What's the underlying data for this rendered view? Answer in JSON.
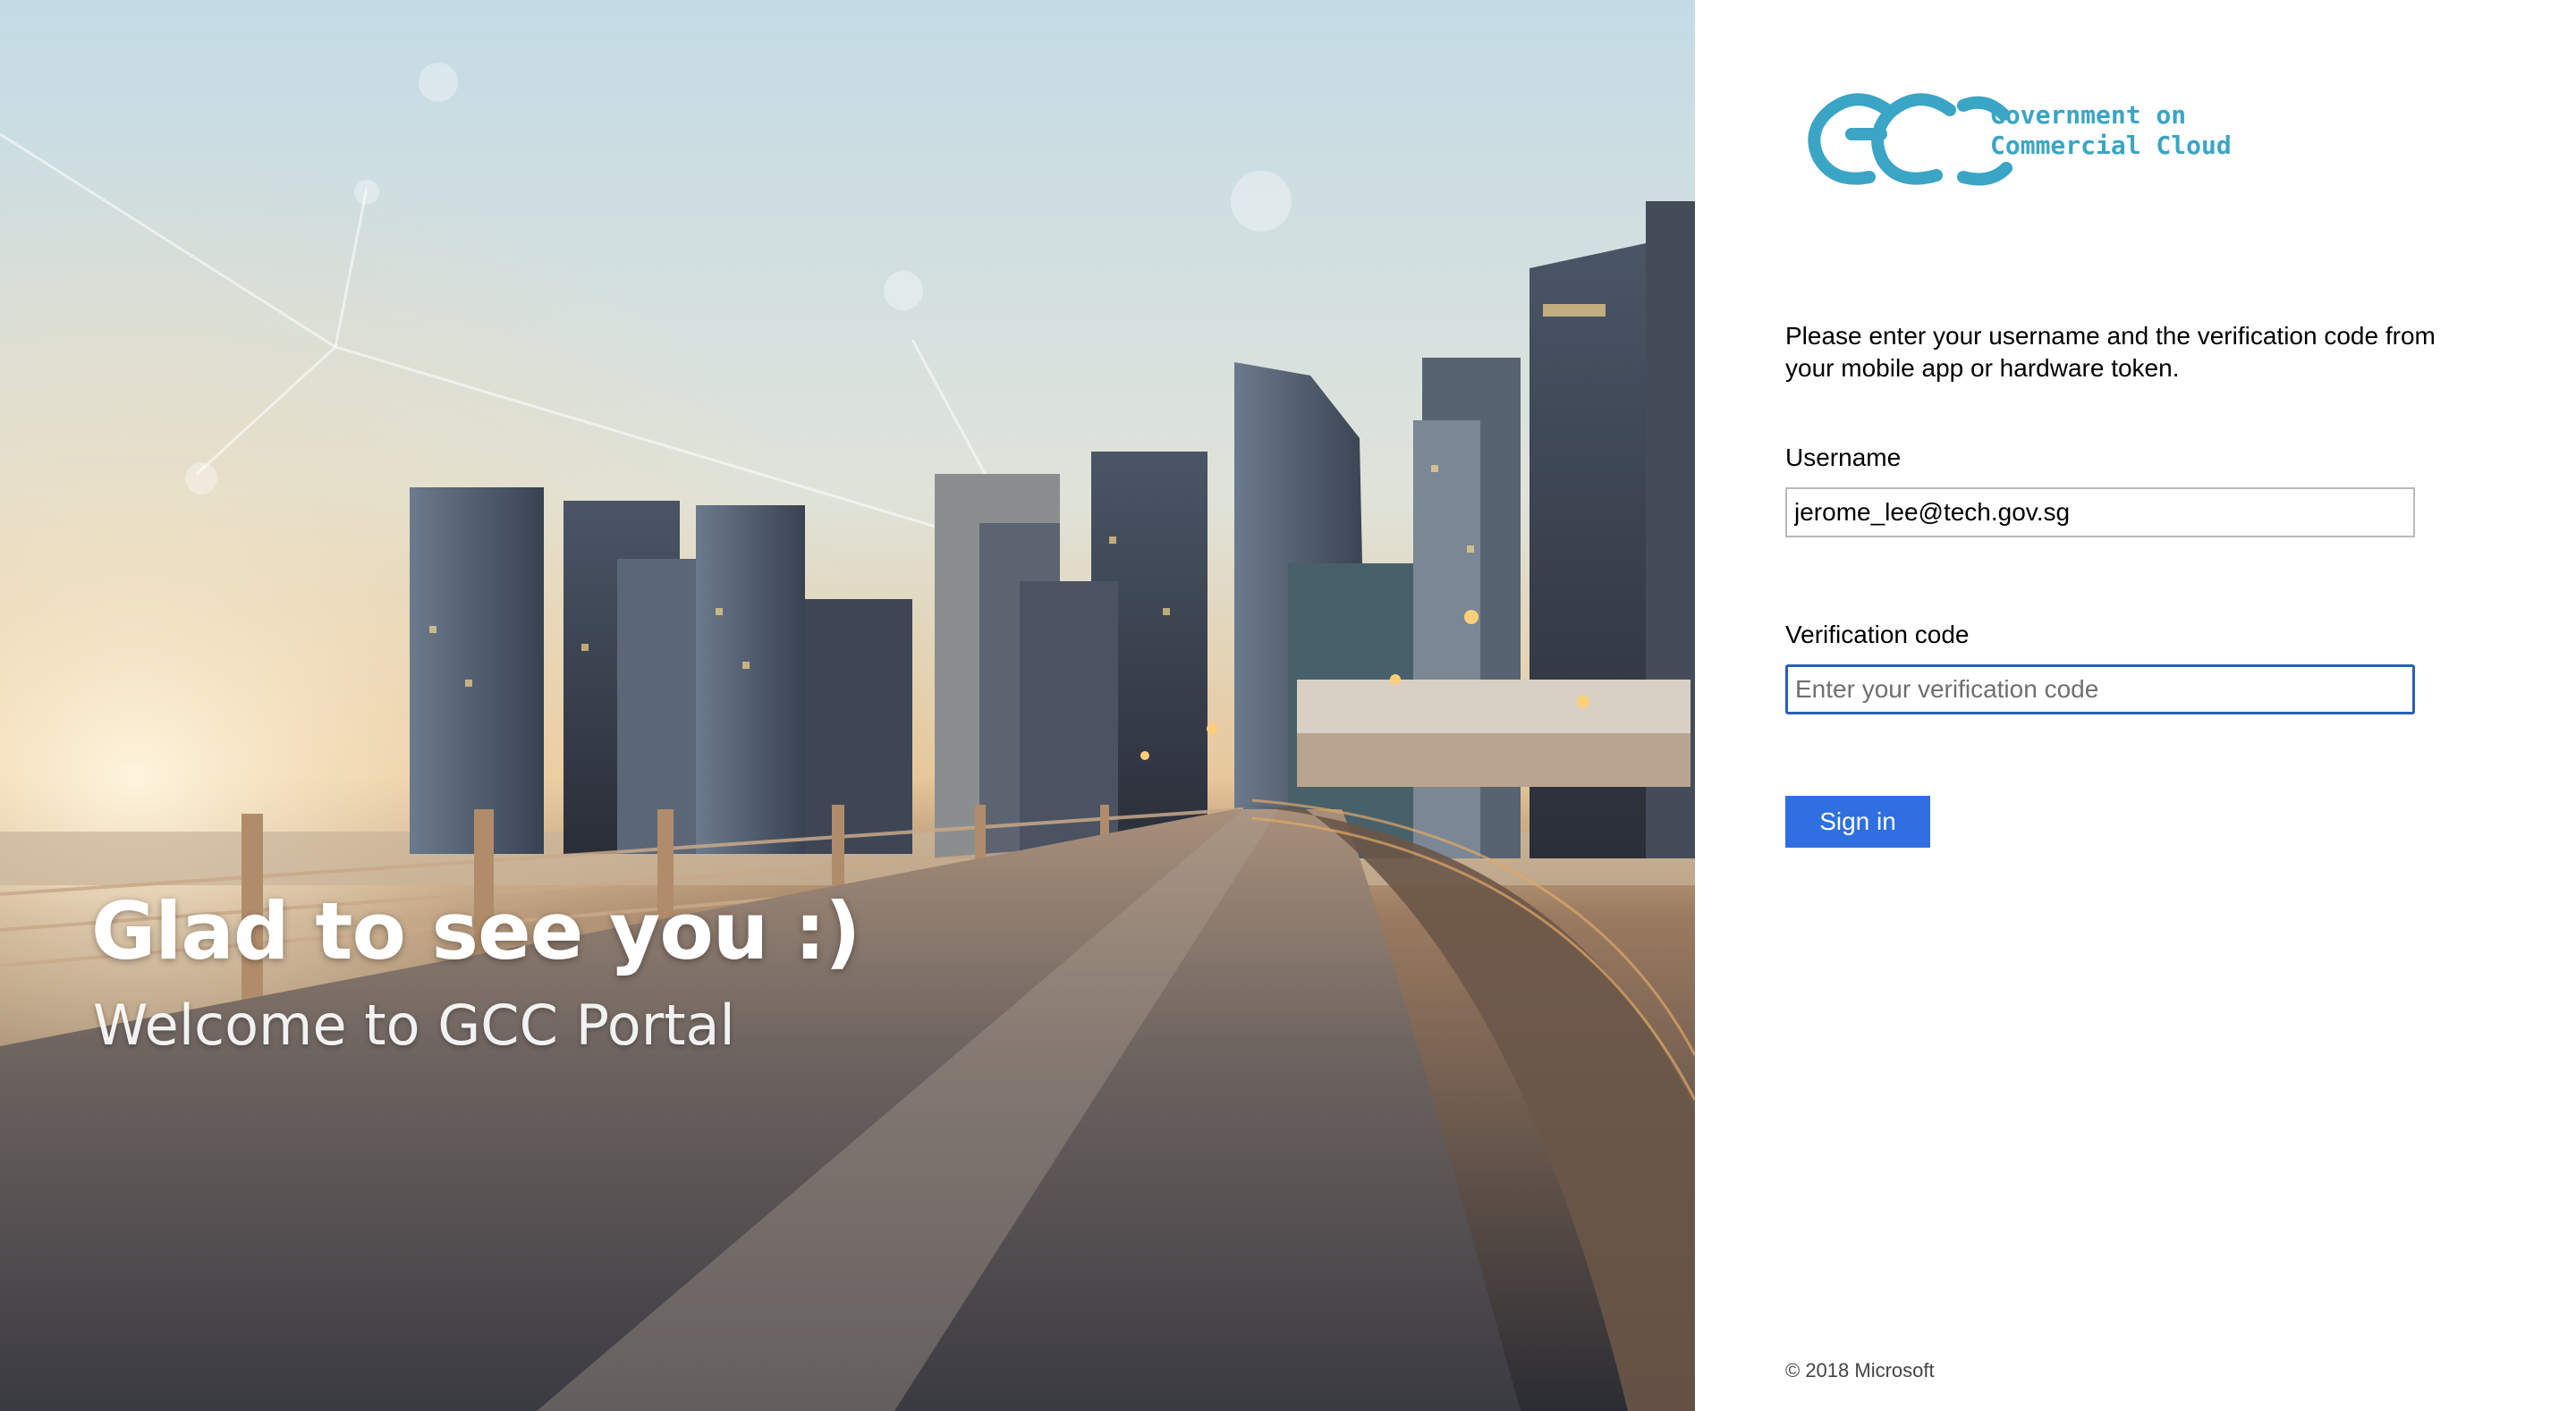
{
  "hero": {
    "title": "Glad to see you :)",
    "subtitle": "Welcome to GCC Portal"
  },
  "logo": {
    "mark": "GCC",
    "line1": "Government on",
    "line2": "Commercial Cloud",
    "color": "#3aa5c4"
  },
  "form": {
    "instructions": "Please enter your username and the verification code from your mobile app or hardware token.",
    "username_label": "Username",
    "username_value": "jerome_lee@tech.gov.sg",
    "code_label": "Verification code",
    "code_placeholder": "Enter your verification code",
    "signin_label": "Sign in",
    "accent_color": "#2f6fe0"
  },
  "footer": {
    "copyright": "© 2018 Microsoft"
  }
}
